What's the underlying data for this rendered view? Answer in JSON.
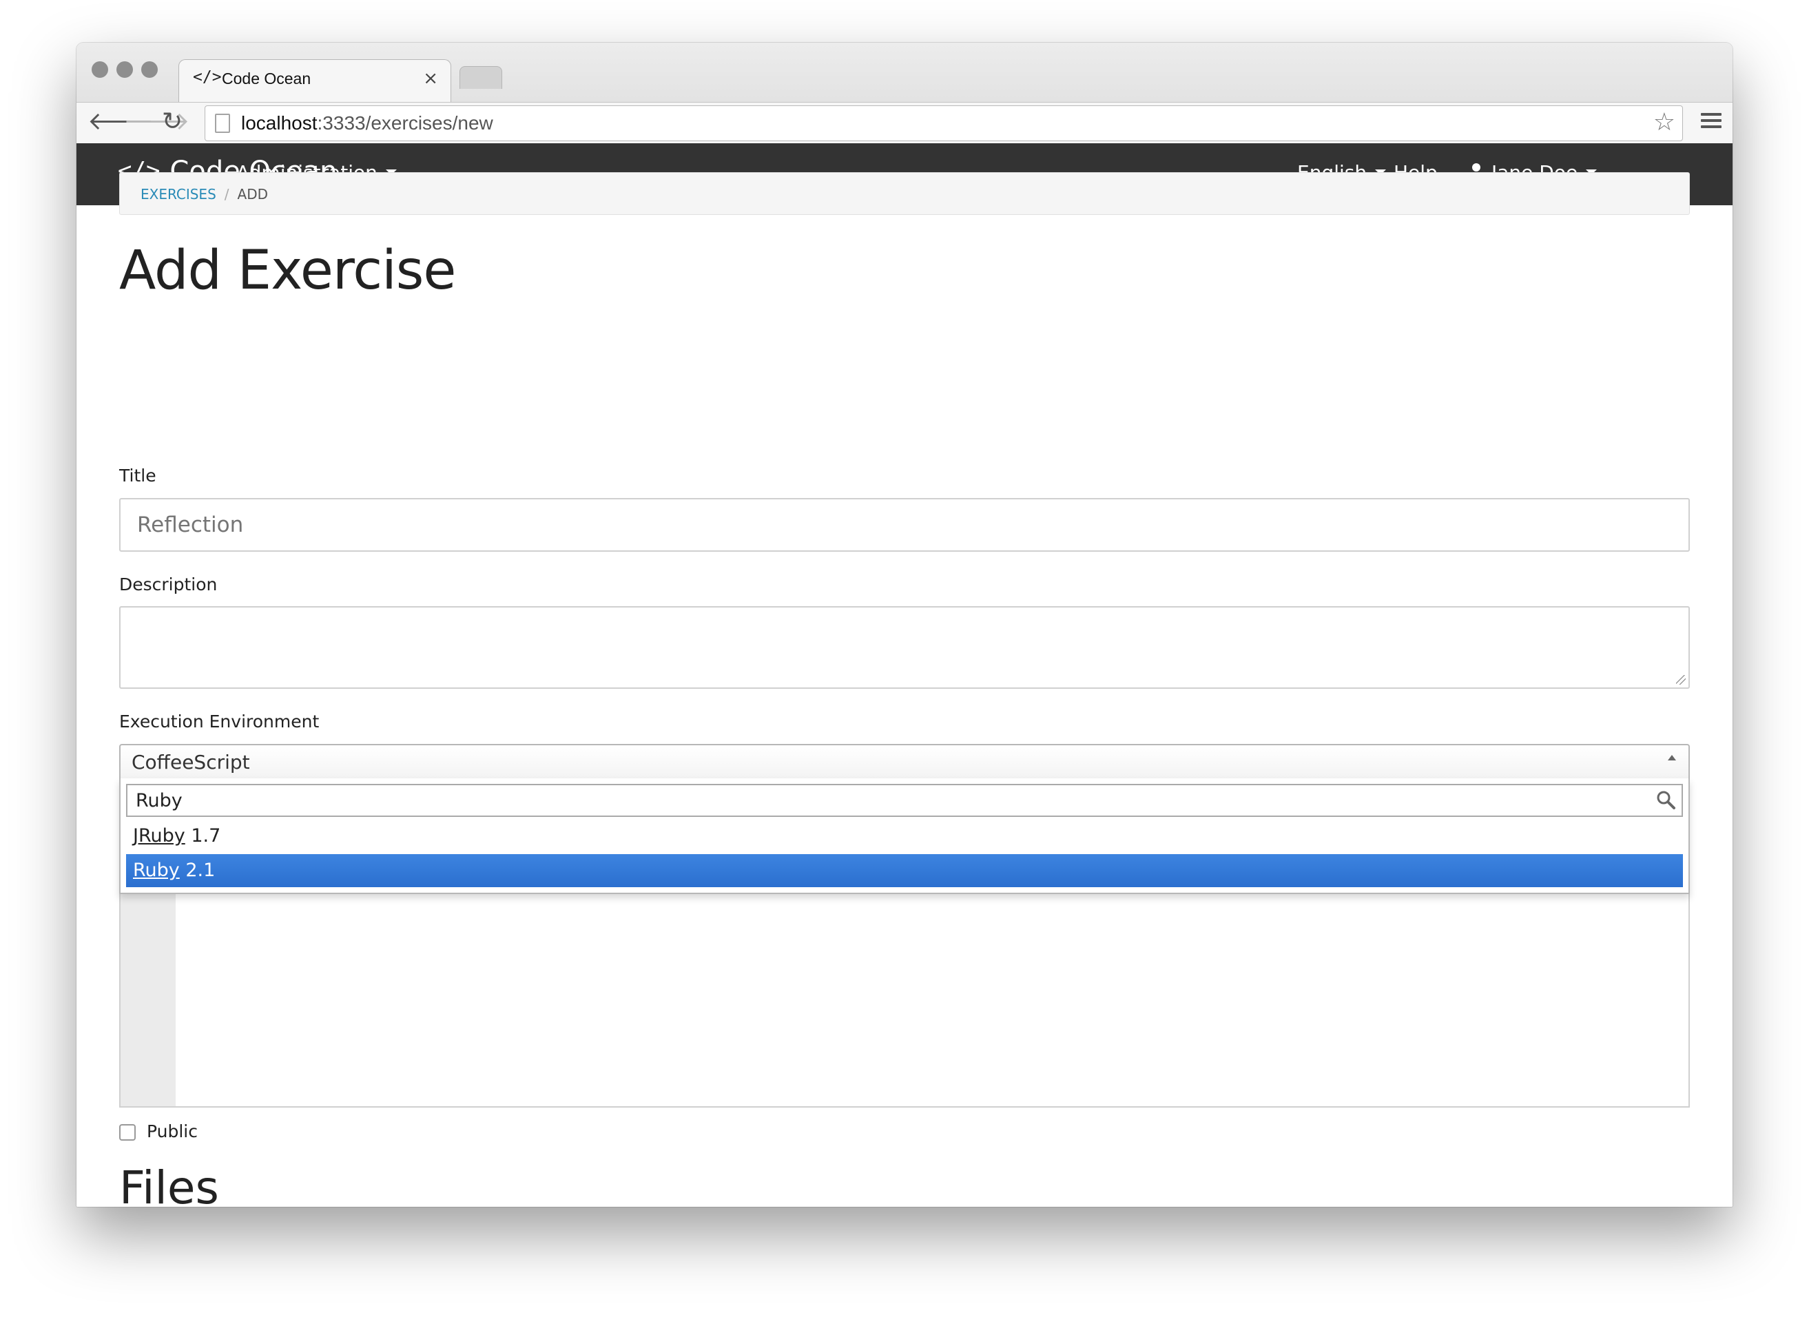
{
  "browser": {
    "tab_title": "Code Ocean",
    "tab_icon": "</>",
    "close_glyph": "×",
    "url_host": "localhost",
    "url_rest": ":3333/exercises/new",
    "back_glyph": "🡐",
    "forward_glyph": "🡒",
    "reload_glyph": "↻",
    "star_glyph": "☆"
  },
  "navbar": {
    "brand_icon": "</>",
    "brand": "Code Ocean",
    "administration": "Administration",
    "language": "English",
    "help": "Help",
    "user": "Jane Doe",
    "background": "#333333"
  },
  "breadcrumb": {
    "exercises": "Exercises",
    "separator": "/",
    "current": "Add"
  },
  "page": {
    "title": "Add Exercise",
    "files_heading": "Files"
  },
  "form": {
    "title_label": "Title",
    "title_placeholder": "Reflection",
    "description_label": "Description",
    "environment_label": "Execution Environment",
    "environment_selected": "CoffeeScript",
    "environment_search": "Ruby",
    "environment_results": [
      {
        "match": "JRuby",
        "rest": " 1.7",
        "highlighted": false
      },
      {
        "match": "Ruby",
        "rest": " 2.1",
        "highlighted": true
      }
    ],
    "public_label": "Public",
    "public_checked": false
  },
  "colors": {
    "highlight": "#3875d7",
    "link": "#2a8bb7"
  }
}
